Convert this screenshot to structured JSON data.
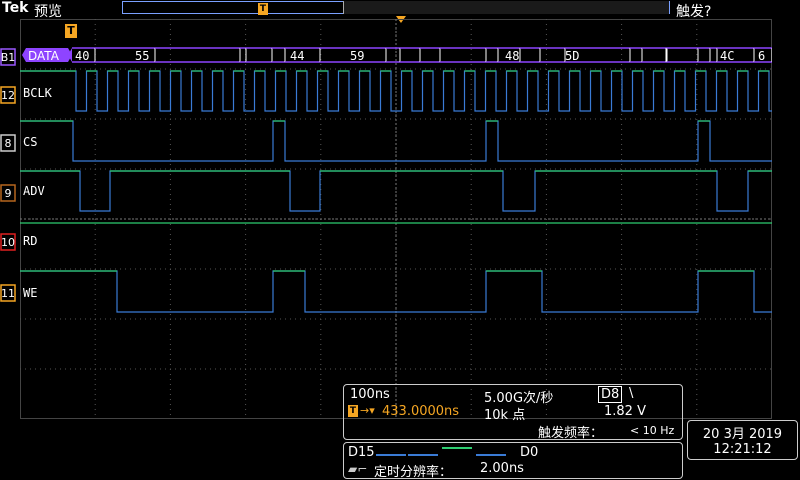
{
  "header": {
    "brand": "Tek",
    "mode": "预览",
    "trigger_status": "触发?",
    "trigger_badge": "T"
  },
  "bus": {
    "label": "B1",
    "name": "DATA",
    "values": [
      "40",
      "55",
      "44",
      "59",
      "48",
      "5D",
      "4C",
      "6"
    ],
    "color": "#9b59ff"
  },
  "channels": [
    {
      "num": "12",
      "name": "BCLK",
      "color": "#f5a623"
    },
    {
      "num": "8",
      "name": "CS",
      "color": "#cccccc"
    },
    {
      "num": "9",
      "name": "ADV",
      "color": "#b5651d"
    },
    {
      "num": "10",
      "name": "RD",
      "color": "#e02020"
    },
    {
      "num": "11",
      "name": "WE",
      "color": "#f5a623"
    }
  ],
  "trace_colors": {
    "high": "#2ecc71",
    "low": "#3a7bd5",
    "grid": "#555555",
    "bus": "#8e44ff"
  },
  "info": {
    "timebase": "100ns",
    "sample_rate": "5.00G次/秒",
    "trigger_source": "D8",
    "slope": "\\",
    "position": "433.0000ns",
    "record_length": "10k 点",
    "trigger_level": "1.82 V",
    "trigger_freq_label": "触发频率：",
    "trigger_freq": "< 10 Hz"
  },
  "digital": {
    "high_label": "D15",
    "low_label": "D0",
    "resolution_label": "定时分辨率：",
    "resolution": "2.00ns"
  },
  "datetime": {
    "date": "20 3月 2019",
    "time": "12:21:12"
  }
}
